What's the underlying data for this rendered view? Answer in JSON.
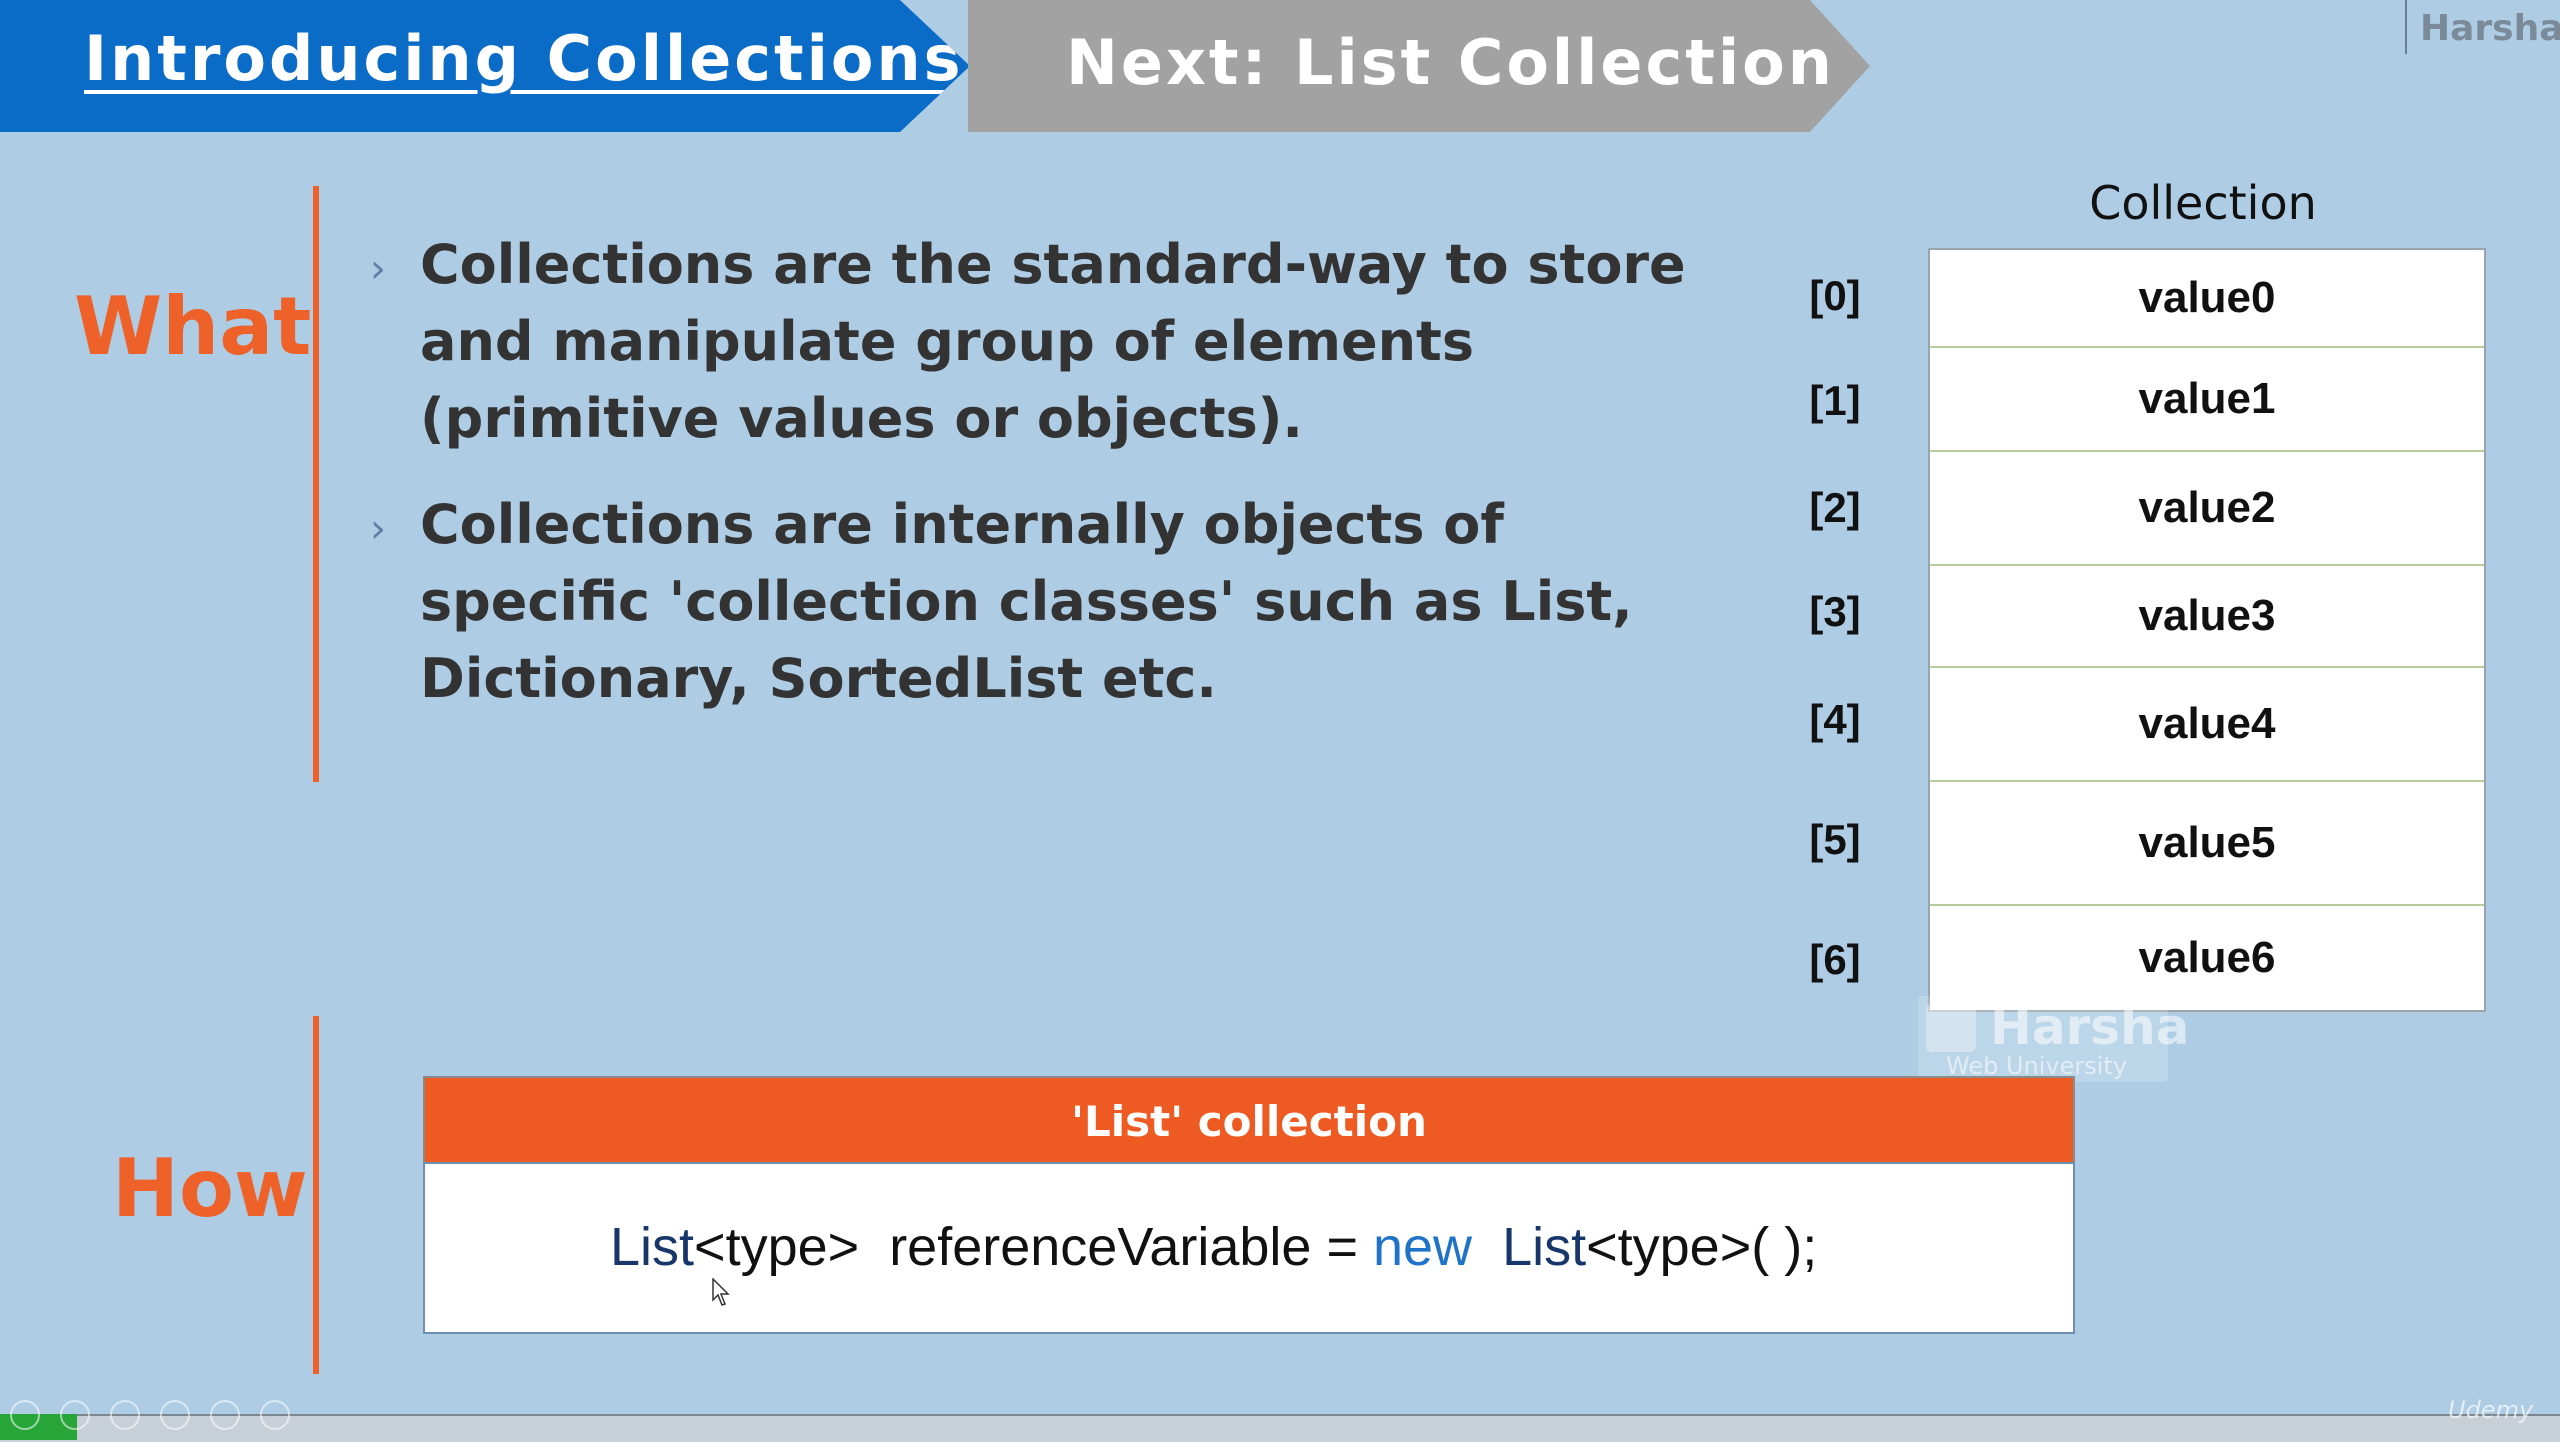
{
  "header": {
    "current_title": "Introducing Collections",
    "next_title": "Next: List Collection",
    "brand": "Harsha"
  },
  "what": {
    "label": "What",
    "bullets": [
      "Collections are the standard-way to store and manipulate group of elements (primitive values or objects).",
      "Collections are internally objects of specific 'collection classes' such as List, Dictionary, SortedList etc."
    ]
  },
  "collection": {
    "title": "Collection",
    "indices": [
      "[0]",
      "[1]",
      "[2]",
      "[3]",
      "[4]",
      "[5]",
      "[6]"
    ],
    "values": [
      "value0",
      "value1",
      "value2",
      "value3",
      "value4",
      "value5",
      "value6"
    ]
  },
  "watermark": {
    "name": "Harsha",
    "subtitle": "Web University"
  },
  "how": {
    "label": "How",
    "box_title": "'List' collection",
    "code": {
      "type1": "List",
      "generic1": "<type>  referenceVariable = ",
      "keyword": "new",
      "type2": "List",
      "generic2": "<type>( );"
    }
  },
  "player": {
    "logo": "Udemy",
    "progress_fraction": 0.03
  },
  "colors": {
    "accent_orange": "#ee6229",
    "tab_blue": "#0b6cc8",
    "tab_gray": "#a2a2a2",
    "background": "#aecde5"
  }
}
